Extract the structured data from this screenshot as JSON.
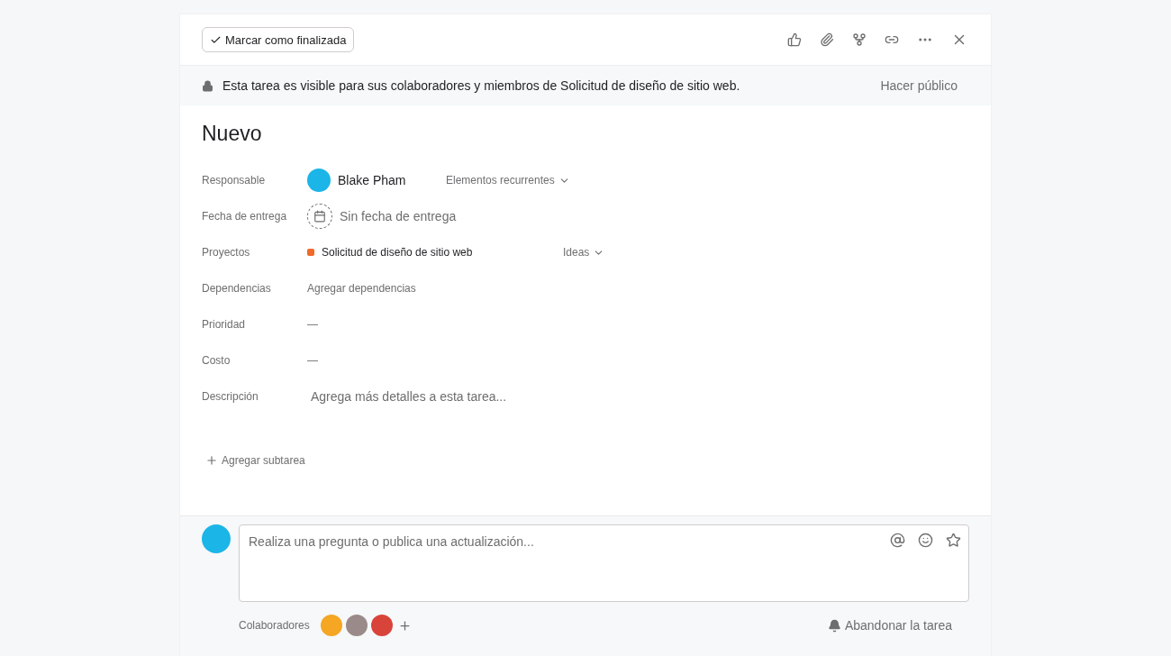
{
  "toolbar": {
    "complete_button": "Marcar como finalizada"
  },
  "banner": {
    "text": "Esta tarea es visible para sus colaboradores y miembros de Solicitud de diseño de sitio web.",
    "action": "Hacer público"
  },
  "title": "Nuevo",
  "fields": [
    {
      "kind": "assignee",
      "label": "Responsable",
      "value": "Blake Pham",
      "extra": "Elementos recurrentes"
    },
    {
      "kind": "date",
      "label": "Fecha de entrega",
      "value": "Sin fecha de entrega"
    },
    {
      "kind": "project",
      "label": "Proyectos",
      "value": "Solicitud de diseño de sitio web",
      "color": "#f06a2a",
      "extra": "Ideas"
    },
    {
      "kind": "link",
      "label": "Dependencias",
      "value": "Agregar dependencias"
    },
    {
      "kind": "dash",
      "label": "Prioridad",
      "value": "—"
    },
    {
      "kind": "dash",
      "label": "Costo",
      "value": "—"
    },
    {
      "kind": "placeholder",
      "label": "Descripción",
      "value": "Agrega más detalles a esta tarea..."
    }
  ],
  "add_subtask": "Agregar subtarea",
  "comment": {
    "placeholder": "Realiza una pregunta o publica una actualización..."
  },
  "collaborators": {
    "label": "Colaboradores",
    "people": [
      {
        "color": "#f5a623"
      },
      {
        "color": "#9b8a8a"
      },
      {
        "color": "#d9443a"
      }
    ]
  },
  "leave_button": "Abandonar la tarea"
}
